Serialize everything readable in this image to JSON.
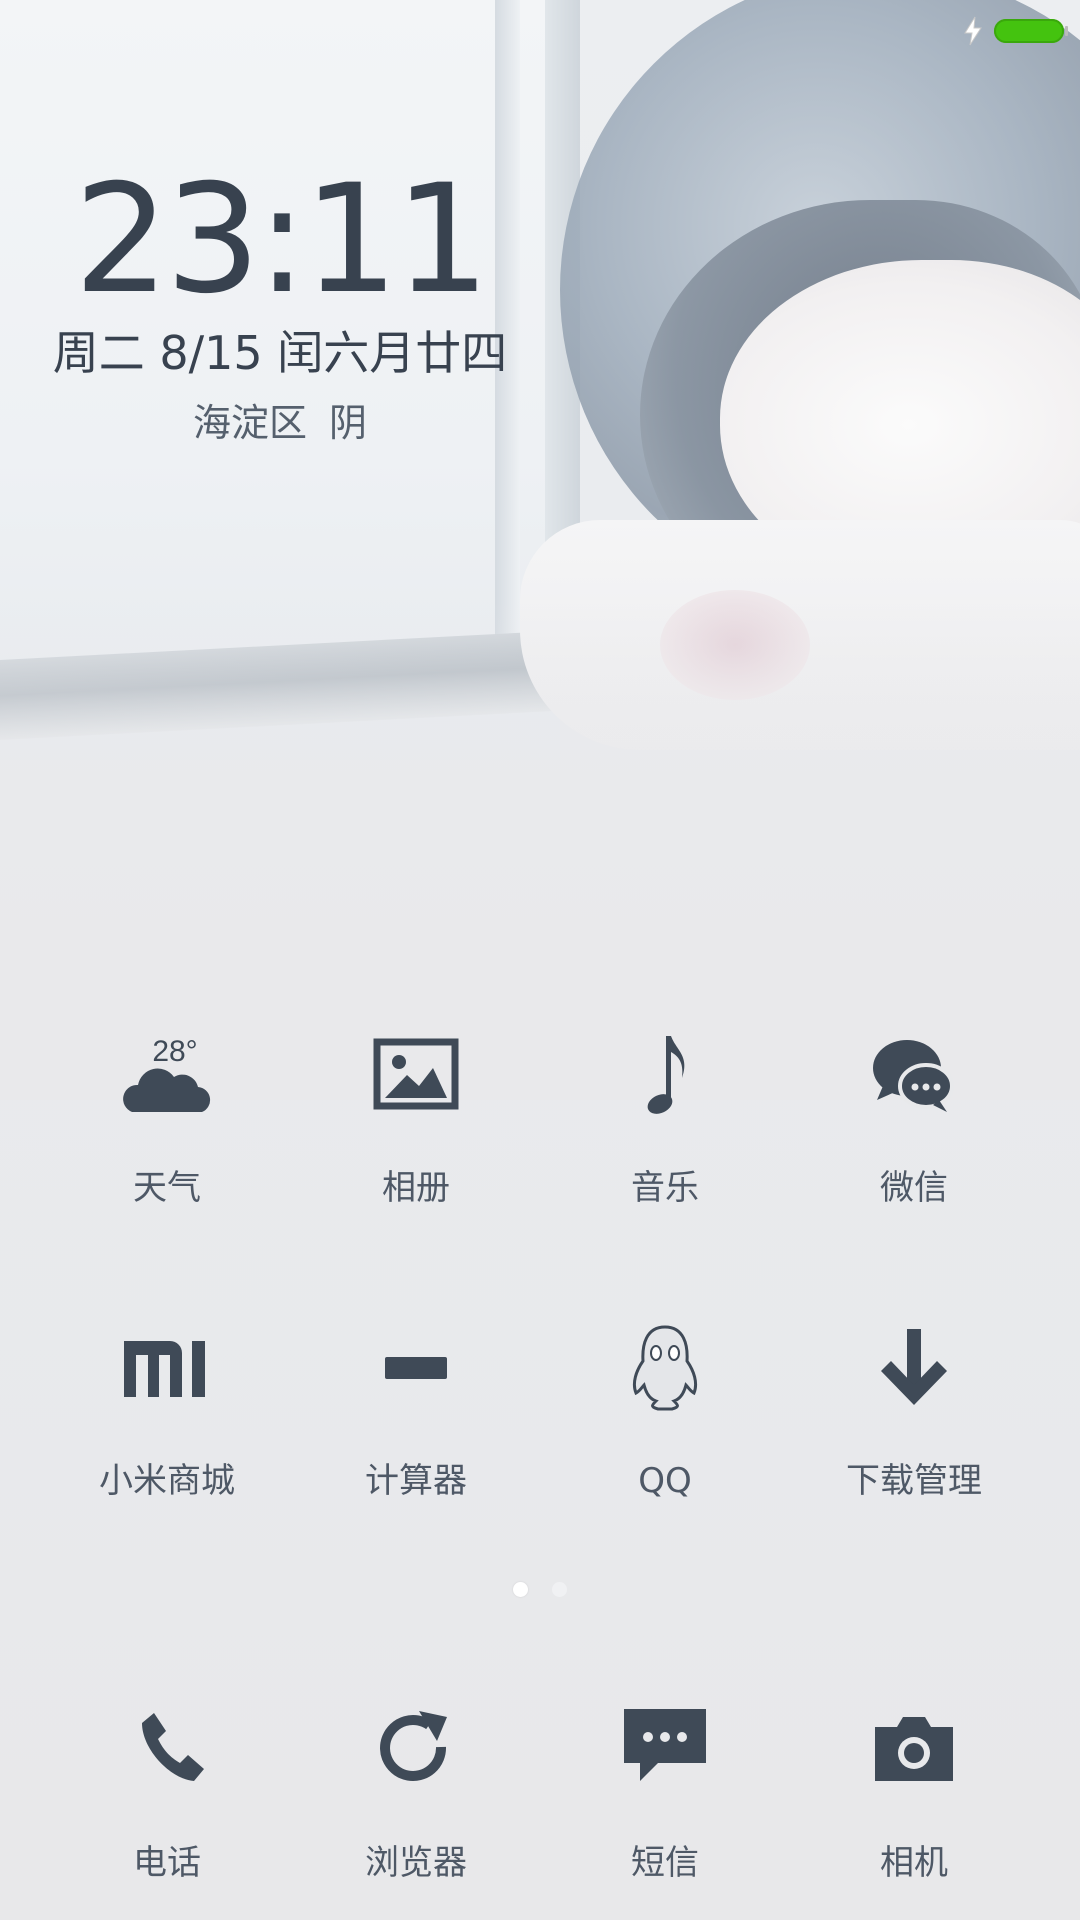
{
  "status": {
    "battery_color": "#44c30f",
    "charging_icon": "charging-bolt-icon"
  },
  "lockclock": {
    "time": "23:11",
    "date": "周二 8/15 闰六月廿四",
    "location": "海淀区",
    "condition": "阴"
  },
  "apps": [
    {
      "label": "天气",
      "icon": "weather-cloud-icon",
      "temp": "28°"
    },
    {
      "label": "相册",
      "icon": "gallery-picture-icon"
    },
    {
      "label": "音乐",
      "icon": "music-note-icon"
    },
    {
      "label": "微信",
      "icon": "wechat-icon"
    },
    {
      "label": "小米商城",
      "icon": "mi-logo-icon"
    },
    {
      "label": "计算器",
      "icon": "calculator-minus-icon"
    },
    {
      "label": "QQ",
      "icon": "qq-penguin-icon"
    },
    {
      "label": "下载管理",
      "icon": "download-arrow-icon"
    }
  ],
  "page_indicator": {
    "pages": 2,
    "current": 1
  },
  "dock": [
    {
      "label": "电话",
      "icon": "phone-handset-icon"
    },
    {
      "label": "浏览器",
      "icon": "browser-refresh-icon"
    },
    {
      "label": "短信",
      "icon": "sms-bubble-icon"
    },
    {
      "label": "相机",
      "icon": "camera-icon"
    }
  ],
  "icon_color": "#3f4a57"
}
